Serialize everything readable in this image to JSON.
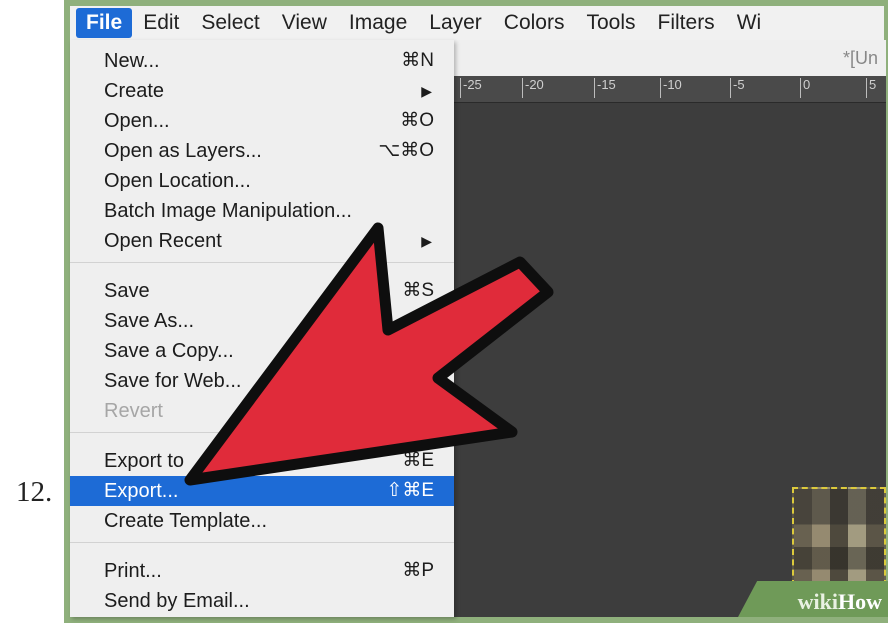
{
  "step": "12.",
  "menubar": {
    "items": [
      "File",
      "Edit",
      "Select",
      "View",
      "Image",
      "Layer",
      "Colors",
      "Tools",
      "Filters",
      "Wi"
    ]
  },
  "canvas": {
    "title": "*[Un",
    "ruler": [
      "-25",
      "-20",
      "-15",
      "-10",
      "-5",
      "0",
      "5"
    ]
  },
  "file_menu": {
    "items": [
      {
        "label": "New...",
        "shortcut": "⌘N"
      },
      {
        "label": "Create",
        "submenu": "▶"
      },
      {
        "label": "Open...",
        "shortcut": "⌘O"
      },
      {
        "label": "Open as Layers...",
        "shortcut": "⌥⌘O"
      },
      {
        "label": "Open Location..."
      },
      {
        "label": "Batch Image Manipulation..."
      },
      {
        "label": "Open Recent",
        "submenu": "▶"
      },
      {
        "label": "Save",
        "shortcut": "⌘S"
      },
      {
        "label": "Save As..."
      },
      {
        "label": "Save a Copy..."
      },
      {
        "label": "Save for Web..."
      },
      {
        "label": "Revert",
        "disabled": true
      },
      {
        "label": "Export to",
        "shortcut": "⌘E"
      },
      {
        "label": "Export...",
        "shortcut": "⇧⌘E",
        "highlighted": true
      },
      {
        "label": "Create Template..."
      },
      {
        "label": "Print...",
        "shortcut": "⌘P"
      },
      {
        "label": "Send by Email..."
      }
    ]
  },
  "watermark": {
    "wiki": "wiki",
    "how": "How"
  },
  "colors": {
    "highlight": "#1d6bd6",
    "arrow": "#e02b3a",
    "frame": "#8fb07c"
  }
}
